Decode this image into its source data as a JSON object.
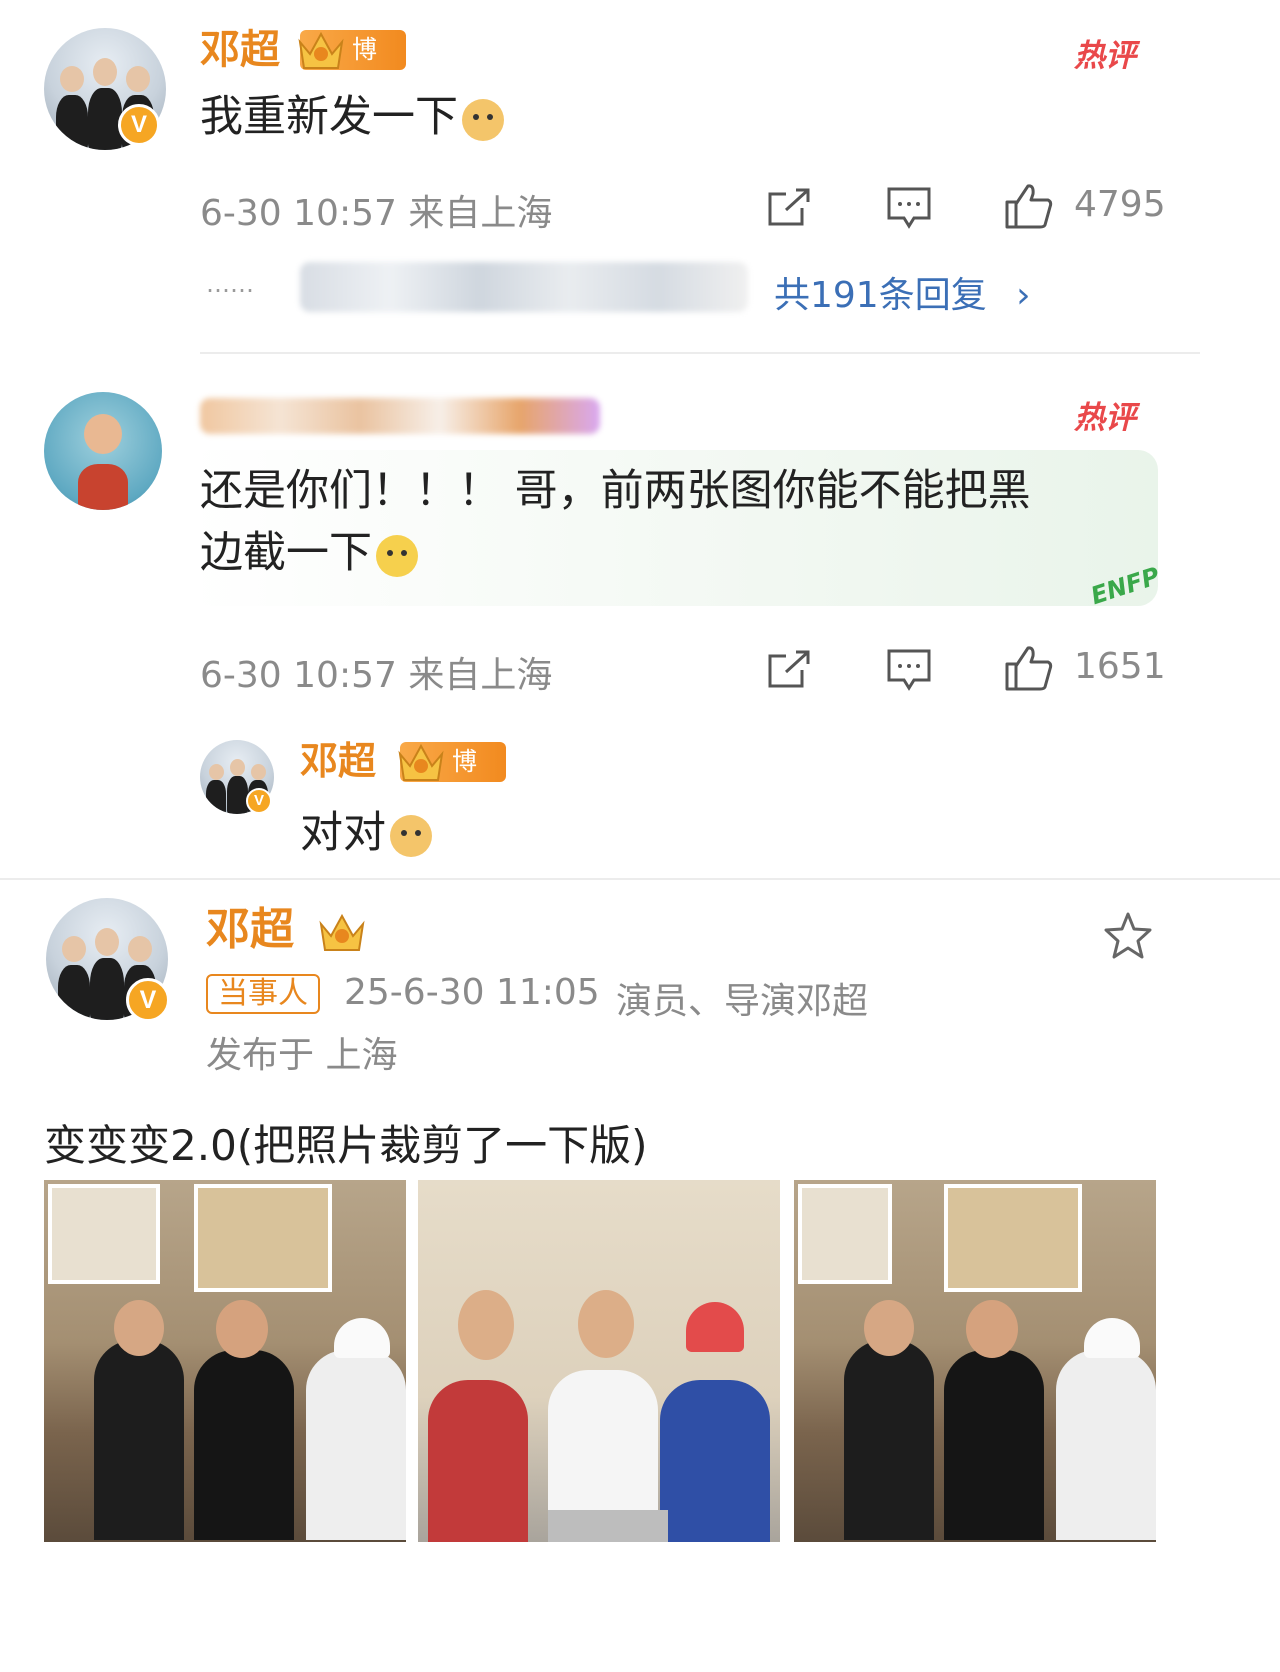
{
  "comment1": {
    "username": "邓超",
    "badge": "博主",
    "hot_label": "热评",
    "text": "我重新发一下",
    "emoji": "doge-emoji",
    "timestamp": "6-30 10:57 来自上海",
    "likes": "4795",
    "replies_dots": "……",
    "replies_link": "共191条回复",
    "replies_chevron": "›"
  },
  "comment2": {
    "hot_label": "热评",
    "text_line1": "还是你们！！！ 哥，前两张图你能不能把黑",
    "text_line2": "边截一下",
    "emoji": "dive-emoji",
    "decoration_text": "ENFP",
    "timestamp": "6-30 10:57 来自上海",
    "likes": "1651"
  },
  "reply": {
    "username": "邓超",
    "badge": "博主",
    "text": "对对",
    "emoji": "doge-emoji"
  },
  "post": {
    "username": "邓超",
    "tag": "当事人",
    "timestamp": "25-6-30 11:05",
    "description": "演员、导演邓超",
    "location": "发布于 上海",
    "text": "变变变2.0(把照片裁剪了一下版)",
    "photos": [
      "photo-1",
      "photo-2",
      "photo-3"
    ]
  },
  "colors": {
    "name_orange": "#e8871e",
    "hot_red": "#e9484a",
    "link_blue": "#3b6fb6",
    "meta_gray": "#8a8a8a"
  }
}
